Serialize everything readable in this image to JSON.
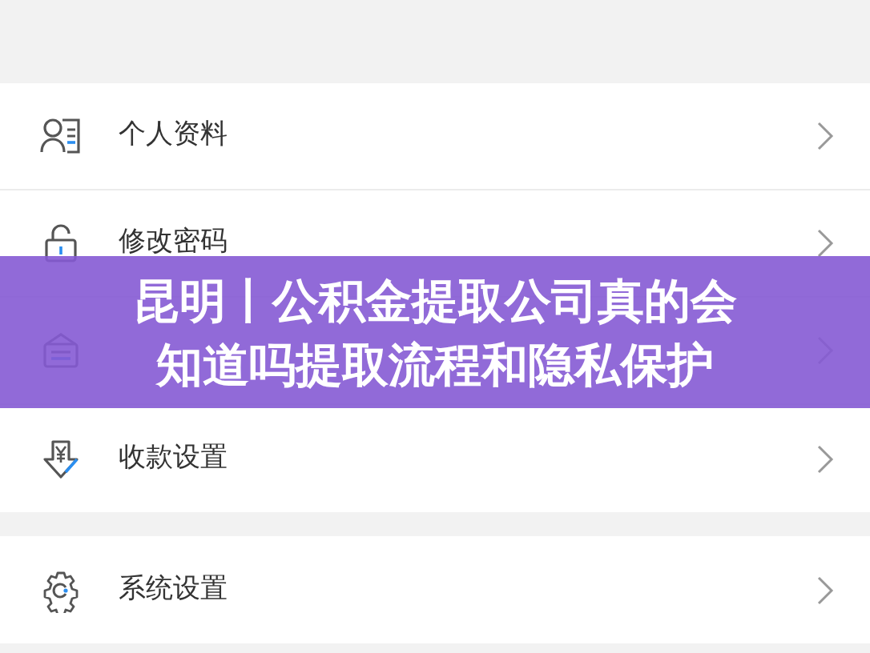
{
  "sections": [
    {
      "items": [
        {
          "kind": "nav",
          "label": "个人资料"
        },
        {
          "kind": "nav",
          "label": "修改密码"
        },
        {
          "kind": "nav"
        },
        {
          "kind": "nav",
          "label": "收款设置"
        }
      ]
    },
    {
      "items": [
        {
          "kind": "nav",
          "label": "系统设置"
        }
      ]
    }
  ],
  "banner": {
    "lines": [
      "昆明丨公积金提取公司真的会",
      "知道吗提取流程和隐私保护"
    ]
  }
}
